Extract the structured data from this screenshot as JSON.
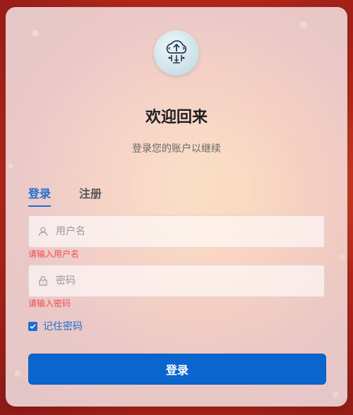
{
  "header": {
    "title": "欢迎回来",
    "subtitle": "登录您的账户以继续"
  },
  "tabs": [
    {
      "label": "登录",
      "active": true
    },
    {
      "label": "注册",
      "active": false
    }
  ],
  "form": {
    "username": {
      "placeholder": "用户名",
      "value": "",
      "error": "请输入用户名",
      "icon": "user-icon"
    },
    "password": {
      "placeholder": "密码",
      "value": "",
      "error": "请输入密码",
      "icon": "lock-icon"
    },
    "remember": {
      "label": "记住密码",
      "checked": true
    },
    "submit_label": "登录"
  },
  "colors": {
    "accent": "#1f6fd1",
    "button": "#0a66cc",
    "error": "#f24a4a"
  }
}
